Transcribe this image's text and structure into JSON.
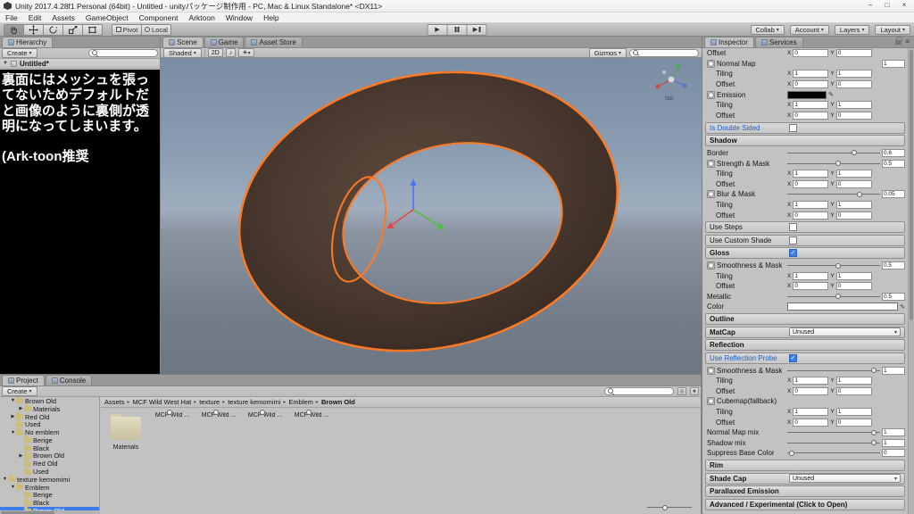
{
  "window": {
    "title": "Unity 2017.4.28f1 Personal (64bit) - Untitled - unityパッケージ制作用 - PC, Mac & Linux Standalone* <DX11>",
    "menus": [
      "File",
      "Edit",
      "Assets",
      "GameObject",
      "Component",
      "Arktoon",
      "Window",
      "Help"
    ],
    "controls": {
      "minimize": "–",
      "maximize": "□",
      "close": "×"
    }
  },
  "glyphs": {
    "chevron": "▾",
    "tri_down": "▼",
    "tri_right": "▶",
    "check": "✓",
    "play": "▶",
    "crumb_sep": "▸",
    "menu": "≡",
    "eyedrop": "✎",
    "audio": "♪",
    "fx": "☀"
  },
  "colors": {
    "selection_outline": "#ff7922",
    "selection_blue": "#3e7de7",
    "brim_dark": "#3a2d25",
    "brim_light": "#5d4a3e"
  },
  "toolbar": {
    "pivot": "Pivot",
    "local": "Local",
    "collab": "Collab",
    "account": "Account",
    "layers": "Layers",
    "layout": "Layout"
  },
  "hierarchy": {
    "tab": "Hierarchy",
    "create": "Create",
    "scene": "Untitled*",
    "annotation": "裏面にはメッシュを張ってないためデフォルトだと画像のように裏側が透明になってしまいます。",
    "annotation2": "(Ark-toon推奨"
  },
  "scene": {
    "tabs": [
      "Scene",
      "Game",
      "Asset Store"
    ],
    "shaded": "Shaded",
    "mode2d": "2D",
    "gizmos": "Gizmos",
    "gizmo_label": "Iso"
  },
  "project": {
    "tabs": [
      "Project",
      "Console"
    ],
    "create": "Create",
    "breadcrumb": [
      "Assets",
      "MCF Wild West Hat",
      "texture",
      "texture kemomimi",
      "Emblem",
      "Brown Old"
    ],
    "tree": [
      {
        "label": "Brown Old",
        "indent": 1,
        "arrow": "open"
      },
      {
        "label": "Materials",
        "indent": 2,
        "arrow": "closed"
      },
      {
        "label": "Red Old",
        "indent": 1,
        "arrow": "closed"
      },
      {
        "label": "Used",
        "indent": 1,
        "arrow": "none"
      },
      {
        "label": "No emblem",
        "indent": 1,
        "arrow": "open"
      },
      {
        "label": "Berige",
        "indent": 2,
        "arrow": "none"
      },
      {
        "label": "Black",
        "indent": 2,
        "arrow": "none"
      },
      {
        "label": "Brown Old",
        "indent": 2,
        "arrow": "closed"
      },
      {
        "label": "Red Old",
        "indent": 2,
        "arrow": "none"
      },
      {
        "label": "Used",
        "indent": 2,
        "arrow": "none"
      },
      {
        "label": "texture kemomimi",
        "indent": 0,
        "arrow": "open"
      },
      {
        "label": "Emblem",
        "indent": 1,
        "arrow": "open"
      },
      {
        "label": "Berige",
        "indent": 2,
        "arrow": "none"
      },
      {
        "label": "Black",
        "indent": 2,
        "arrow": "none"
      },
      {
        "label": "Brown Old",
        "indent": 2,
        "arrow": "none",
        "selected": true
      }
    ],
    "assets": [
      {
        "label": "Materials",
        "kind": "folder"
      },
      {
        "label": "MCF Wild ...",
        "kind": "ring"
      },
      {
        "label": "MCF Wild ...",
        "kind": "darkring"
      },
      {
        "label": "MCF Wild ...",
        "kind": "black"
      },
      {
        "label": "MCF Wild ...",
        "kind": "normal"
      }
    ]
  },
  "inspector": {
    "tabs": [
      "Inspector",
      "Services"
    ],
    "rows": [
      {
        "t": "xy",
        "label": "Offset",
        "x": "0",
        "y": "0"
      },
      {
        "t": "tex",
        "label": "Normal Map",
        "value": "1"
      },
      {
        "t": "xy",
        "label": "Tiling",
        "x": "1",
        "y": "1",
        "indent": 1
      },
      {
        "t": "xy",
        "label": "Offset",
        "x": "0",
        "y": "0",
        "indent": 1
      },
      {
        "t": "texcolor",
        "label": "Emission",
        "color": "#000000"
      },
      {
        "t": "xy",
        "label": "Tiling",
        "x": "1",
        "y": "1",
        "indent": 1
      },
      {
        "t": "xy",
        "label": "Offset",
        "x": "0",
        "y": "0",
        "indent": 1
      },
      {
        "t": "boxcheck",
        "label": "Is Double Sided",
        "checked": false,
        "blue": true
      },
      {
        "t": "header",
        "label": "Shadow"
      },
      {
        "t": "slider",
        "label": "Border",
        "value": "0.6",
        "frac": 0.72
      },
      {
        "t": "slider",
        "icon": true,
        "label": "Strength & Mask",
        "value": "0.5",
        "frac": 0.55
      },
      {
        "t": "xy",
        "label": "Tiling",
        "x": "1",
        "y": "1",
        "indent": 1
      },
      {
        "t": "xy",
        "label": "Offset",
        "x": "0",
        "y": "0",
        "indent": 1
      },
      {
        "t": "slider",
        "icon": true,
        "label": "Blur & Mask",
        "value": "0.05",
        "frac": 0.78
      },
      {
        "t": "xy",
        "label": "Tiling",
        "x": "1",
        "y": "1",
        "indent": 1
      },
      {
        "t": "xy",
        "label": "Offset",
        "x": "0",
        "y": "0",
        "indent": 1
      },
      {
        "t": "boxcheck",
        "label": "Use Steps",
        "checked": false
      },
      {
        "t": "boxcheck",
        "label": "Use Custom Shade",
        "checked": false
      },
      {
        "t": "header",
        "label": "Gloss",
        "checkbox": true,
        "checked": true
      },
      {
        "t": "slider",
        "icon": true,
        "label": "Smoothness & Mask",
        "value": "0.5",
        "frac": 0.55
      },
      {
        "t": "xy",
        "label": "Tiling",
        "x": "1",
        "y": "1",
        "indent": 1
      },
      {
        "t": "xy",
        "label": "Offset",
        "x": "0",
        "y": "0",
        "indent": 1
      },
      {
        "t": "slider",
        "label": "Metallic",
        "value": "0.5",
        "frac": 0.55
      },
      {
        "t": "color",
        "label": "Color",
        "color": "#ffffff"
      },
      {
        "t": "header",
        "label": "Outline"
      },
      {
        "t": "header",
        "label": "MatCap",
        "dropdown": "Unused"
      },
      {
        "t": "header",
        "label": "Reflection"
      },
      {
        "t": "boxcheck",
        "label": "Use Reflection Probe",
        "checked": true,
        "blue": true
      },
      {
        "t": "slider",
        "icon": true,
        "label": "Smoothness & Mask",
        "value": "1",
        "frac": 0.93
      },
      {
        "t": "xy",
        "label": "Tiling",
        "x": "1",
        "y": "1",
        "indent": 1
      },
      {
        "t": "xy",
        "label": "Offset",
        "x": "0",
        "y": "0",
        "indent": 1
      },
      {
        "t": "tex",
        "label": "Cubemap(fallback)"
      },
      {
        "t": "xy",
        "label": "Tiling",
        "x": "1",
        "y": "1",
        "indent": 1
      },
      {
        "t": "xy",
        "label": "Offset",
        "x": "0",
        "y": "0",
        "indent": 1
      },
      {
        "t": "slider",
        "label": "Normal Map mix",
        "value": "1",
        "frac": 0.93
      },
      {
        "t": "slider",
        "label": "Shadow mix",
        "value": "1",
        "frac": 0.93
      },
      {
        "t": "slider",
        "label": "Suppress Base Color",
        "value": "0",
        "frac": 0.05
      },
      {
        "t": "header",
        "label": "Rim"
      },
      {
        "t": "header",
        "label": "Shade Cap",
        "dropdown": "Unused"
      },
      {
        "t": "header",
        "label": "Parallaxed Emission"
      },
      {
        "t": "header",
        "label": "Advanced / Experimental (Click to Open)"
      }
    ]
  }
}
